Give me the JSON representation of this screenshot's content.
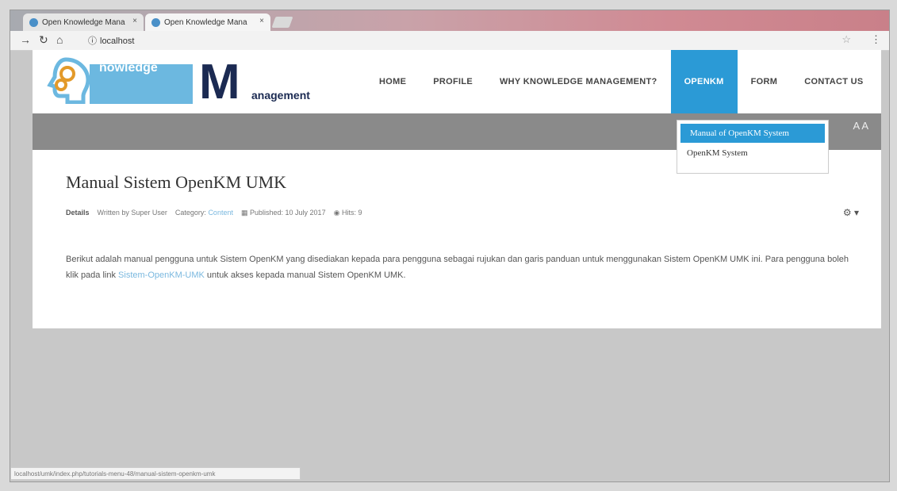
{
  "browser": {
    "tabs": [
      {
        "label": "Open Knowledge Mana",
        "active": false
      },
      {
        "label": "Open Knowledge Mana",
        "active": true
      }
    ],
    "url": "localhost",
    "back_icon": "arrow-right-icon",
    "reload_icon": "reload-icon",
    "home_icon": "home-icon",
    "status_url": "localhost/umk/index.php/tutorials-menu-48/manual-sistem-openkm-umk"
  },
  "site": {
    "logo": {
      "k_text": "nowledge",
      "m_text": "anagement"
    },
    "nav": [
      {
        "label": "HOME"
      },
      {
        "label": "PROFILE"
      },
      {
        "label": "WHY KNOWLEDGE MANAGEMENT?"
      },
      {
        "label": "OPENKM"
      },
      {
        "label": "FORM"
      },
      {
        "label": "CONTACT US"
      }
    ],
    "dropdown": [
      {
        "label": "Manual of OpenKM System"
      },
      {
        "label": "OpenKM System"
      }
    ],
    "font_resize": "A A"
  },
  "article": {
    "title": "Manual Sistem OpenKM UMK",
    "meta": {
      "details": "Details",
      "written_by": "Written by Super User",
      "category_label": "Category:",
      "category": "Content",
      "published": "Published: 10 July 2017",
      "hits": "Hits: 9"
    },
    "body_prefix": "Berikut adalah manual pengguna untuk Sistem OpenKM yang disediakan kepada para pengguna sebagai rujukan dan garis panduan untuk menggunakan Sistem OpenKM UMK ini. Para pengguna boleh klik pada link ",
    "body_link": "Sistem-OpenKM-UMK",
    "body_suffix": " untuk akses kepada manual Sistem OpenKM UMK."
  },
  "colors": {
    "accent": "#2b9ad6",
    "link": "#7ab8df",
    "logo_dark": "#1b2a52",
    "logo_light": "#6cb8e0",
    "band": "#8a8a8a"
  }
}
